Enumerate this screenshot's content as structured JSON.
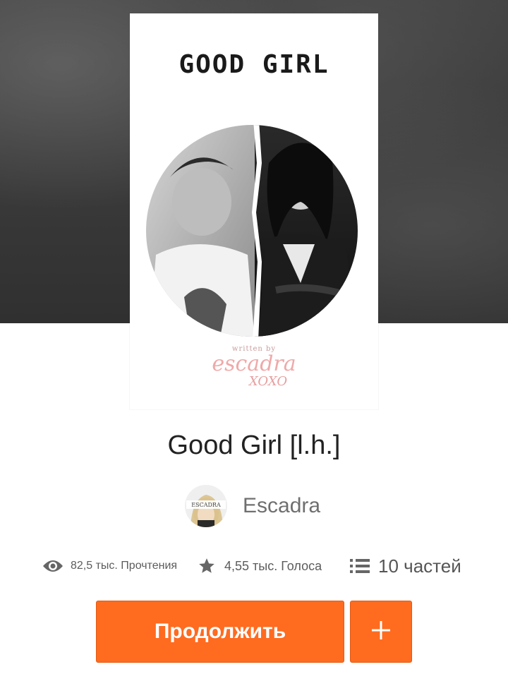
{
  "story": {
    "title": "Good Girl [l.h.]",
    "cover": {
      "title": "GOOD GIRL",
      "credit_small": "written by",
      "credit_name": "escadra",
      "credit_sign": "XOXO"
    },
    "author": {
      "name": "Escadra",
      "avatar_text": "ESCADRA"
    },
    "stats": {
      "reads": "82,5 тыс. Прочтения",
      "votes": "4,55 тыс. Голоса",
      "parts": "10 частей"
    }
  },
  "actions": {
    "continue_label": "Продолжить",
    "add_label": "+"
  },
  "icons": {
    "reads": "eye-icon",
    "votes": "star-icon",
    "parts": "list-icon",
    "add": "plus-icon"
  },
  "colors": {
    "accent": "#ff6b1f",
    "text_primary": "#222222",
    "text_secondary": "#6f6f6f",
    "credit_pink": "#efa9a9"
  }
}
